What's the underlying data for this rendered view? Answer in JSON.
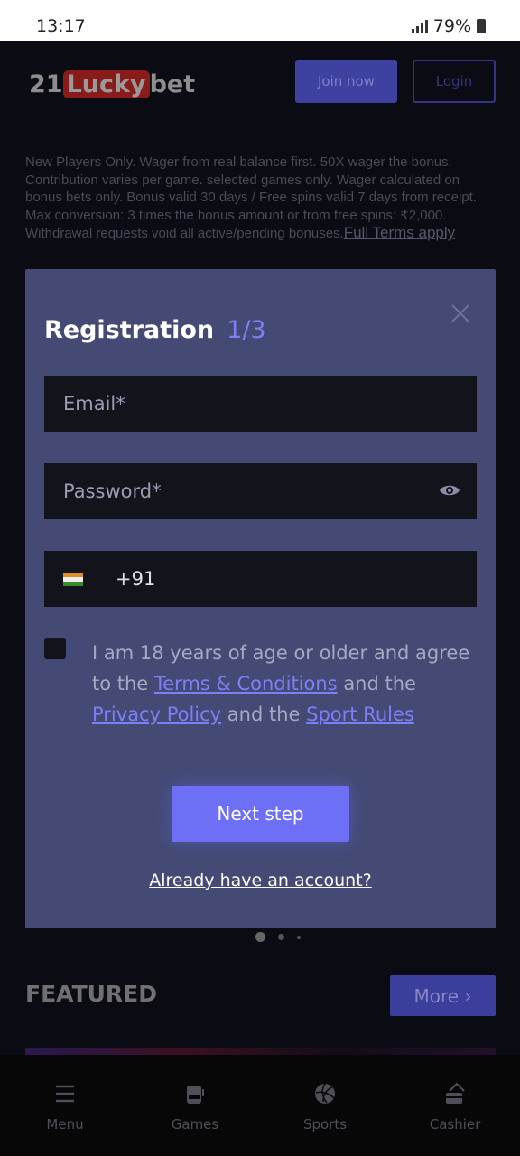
{
  "status_bar": {
    "time": "13:17",
    "battery": "79%"
  },
  "header": {
    "logo": {
      "part1": "21",
      "part2": "Lucky",
      "part3": "bet"
    },
    "join_label": "Join now",
    "login_label": "Login"
  },
  "terms": {
    "text": "New Players Only. Wager from real balance first. 50X wager the bonus. Contribution varies per game. selected games only. Wager calculated on bonus bets only. Bonus valid 30 days / Free spins valid 7 days from receipt. Max conversion: 3 times the bonus amount or from free spins: ₹2,000. Withdrawal requests void all active/pending bonuses.",
    "link": "Full Terms apply"
  },
  "registration": {
    "title": "Registration",
    "step": "1/3",
    "email_placeholder": "Email*",
    "password_placeholder": "Password*",
    "phone_code": "+91",
    "agree": {
      "t1": "I am 18 years of age or older and agree to the ",
      "terms": "Terms & Conditions",
      "t2": " and the ",
      "privacy": "Privacy Policy",
      "t3": " and the ",
      "sport": "Sport Rules"
    },
    "next_label": "Next step",
    "already_label": "Already have an account?"
  },
  "featured": {
    "title": "FEATURED",
    "more_label": "More ›"
  },
  "bottom_nav": [
    {
      "label": "Menu",
      "icon": "menu-icon"
    },
    {
      "label": "Games",
      "icon": "slot-machine-icon"
    },
    {
      "label": "Sports",
      "icon": "volleyball-icon"
    },
    {
      "label": "Cashier",
      "icon": "wallet-card-icon"
    }
  ],
  "colors": {
    "accent": "#6d6ff7",
    "modal_bg": "#444a73",
    "field_bg": "#13131c"
  }
}
